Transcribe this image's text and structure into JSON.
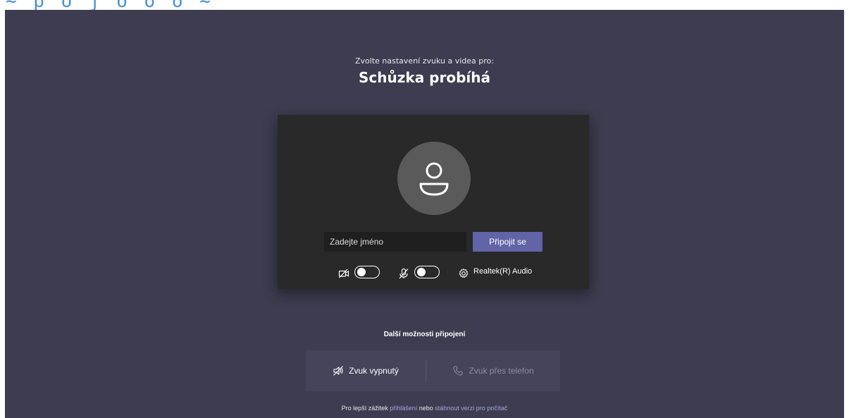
{
  "prejoin": {
    "subtitle": "Zvolte nastavení zvuku a videa pro:",
    "meeting_title": "Schůzka probíhá"
  },
  "join_card": {
    "name_placeholder": "Zadejte jméno",
    "name_value": "",
    "join_button": "Připojit se",
    "camera_toggle_on": false,
    "mic_toggle_on": false,
    "audio_device": "Realtek(R) Audio",
    "icons": [
      "avatar-icon",
      "camera-off-icon",
      "mic-off-icon",
      "settings-icon"
    ]
  },
  "more_options": {
    "heading": "Další možnosti připojení",
    "audio_off": "Zvuk vypnutý",
    "phone_audio": "Zvuk přes telefon"
  },
  "footer": {
    "prefix": "Pro lepší zážitek ",
    "login_link": "přihlášení",
    "middle": " nebo ",
    "download_link": "stáhnout verzi pro počítač"
  },
  "colors": {
    "background": "#3d3c50",
    "card": "#292929",
    "accent": "#6264a7",
    "link": "#a6a7dc"
  }
}
